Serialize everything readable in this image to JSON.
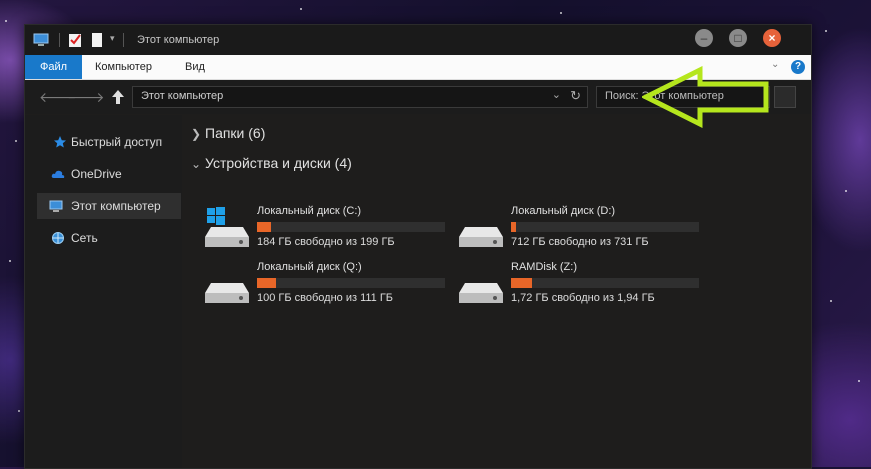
{
  "window": {
    "title": "Этот компьютер",
    "buttons": [
      "–",
      "□",
      "×"
    ]
  },
  "ribbon": {
    "tabs": [
      "Файл",
      "Компьютер",
      "Вид"
    ],
    "help": "?"
  },
  "address": {
    "path": "Этот компьютер",
    "search_placeholder": "Поиск: Этот компьютер"
  },
  "sidebar": {
    "items": [
      {
        "label": "Быстрый доступ",
        "icon": "star-icon"
      },
      {
        "label": "OneDrive",
        "icon": "cloud-icon"
      },
      {
        "label": "Этот компьютер",
        "icon": "computer-icon",
        "selected": true
      },
      {
        "label": "Сеть",
        "icon": "network-icon"
      }
    ]
  },
  "groups": {
    "folders": "Папки (6)",
    "devices": "Устройства и диски (4)"
  },
  "drives": [
    {
      "name": "Локальный диск (C:)",
      "free": "184 ГБ свободно из 199 ГБ",
      "used_fraction": 0.075,
      "system": true
    },
    {
      "name": "Локальный диск (D:)",
      "free": "712 ГБ свободно из 731 ГБ",
      "used_fraction": 0.026,
      "system": false
    },
    {
      "name": "Локальный диск (Q:)",
      "free": "100 ГБ свободно из 111 ГБ",
      "used_fraction": 0.099,
      "system": false
    },
    {
      "name": "RAMDisk (Z:)",
      "free": "1,72 ГБ свободно из 1,94 ГБ",
      "used_fraction": 0.113,
      "system": false
    }
  ],
  "colors": {
    "accent": "#1979ca",
    "bar_fill": "#e86628",
    "annotation_arrow": "#b5e61d"
  }
}
